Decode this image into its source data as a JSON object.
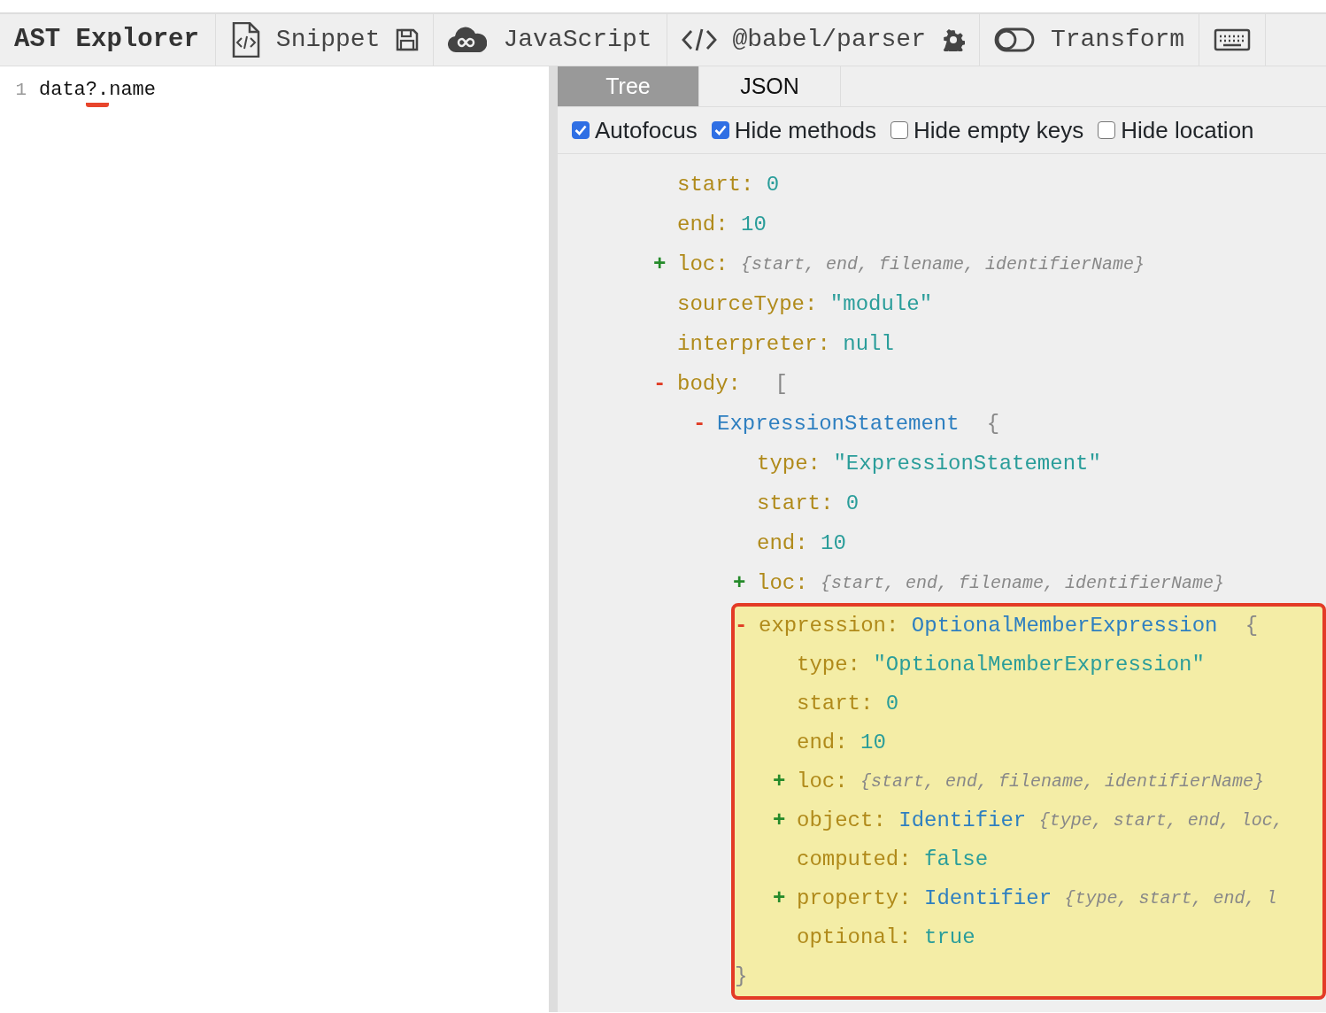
{
  "toolbar": [
    {
      "kind": "brand",
      "label": "AST Explorer"
    },
    {
      "kind": "item",
      "label": "Snippet"
    },
    {
      "kind": "item",
      "label": "JavaScript"
    },
    {
      "kind": "item",
      "label": "@babel/parser"
    },
    {
      "kind": "item",
      "label": "Transform"
    },
    {
      "kind": "item"
    }
  ],
  "editor": {
    "lines": [
      {
        "number": "1",
        "segments": [
          {
            "text": "data",
            "marked": false
          },
          {
            "text": "?.",
            "marked": true
          },
          {
            "text": "name",
            "marked": false
          }
        ]
      }
    ]
  },
  "tabs": [
    {
      "label": "Tree",
      "selected": true
    },
    {
      "label": "JSON",
      "selected": false
    }
  ],
  "options": [
    {
      "label": "Autofocus",
      "checked": true
    },
    {
      "label": "Hide methods",
      "checked": true
    },
    {
      "label": "Hide empty keys",
      "checked": false
    },
    {
      "label": "Hide location",
      "checked": false
    }
  ],
  "tree": [
    {
      "key": "start:",
      "value": "0",
      "kind": "literal"
    },
    {
      "key": "end:",
      "value": "10",
      "kind": "literal"
    },
    {
      "toggle": "+",
      "key": "loc:",
      "expanded": false,
      "value": "{start, end, filename, identifierName}",
      "kind": "summary"
    },
    {
      "key": "sourceType:",
      "value": "\"module\"",
      "kind": "literal"
    },
    {
      "key": "interpreter:",
      "value": "null",
      "kind": "literal"
    },
    {
      "toggle": "-",
      "key": "body:",
      "expanded": true,
      "bracket": "[",
      "children": [
        {
          "toggle": "-",
          "value": "ExpressionStatement",
          "kind": "type",
          "expanded": true,
          "bracket": "{",
          "children": [
            {
              "key": "type:",
              "value": "\"ExpressionStatement\"",
              "kind": "literal"
            },
            {
              "key": "start:",
              "value": "0",
              "kind": "literal"
            },
            {
              "key": "end:",
              "value": "10",
              "kind": "literal"
            },
            {
              "toggle": "+",
              "key": "loc:",
              "expanded": false,
              "value": "{start, end, filename, identifierName}",
              "kind": "summary"
            },
            {
              "toggle": "-",
              "key": "expression:",
              "value": "OptionalMemberExpression",
              "kind": "type",
              "expanded": true,
              "highlighted": true,
              "bracket": "{",
              "closing": "}",
              "children": [
                {
                  "key": "type:",
                  "value": "\"OptionalMemberExpression\"",
                  "kind": "literal"
                },
                {
                  "key": "start:",
                  "value": "0",
                  "kind": "literal"
                },
                {
                  "key": "end:",
                  "value": "10",
                  "kind": "literal"
                },
                {
                  "toggle": "+",
                  "key": "loc:",
                  "expanded": false,
                  "value": "{start, end, filename, identifierName}",
                  "kind": "summary"
                },
                {
                  "toggle": "+",
                  "key": "object:",
                  "expanded": false,
                  "value": "Identifier",
                  "kind": "type",
                  "summary": "{type, start, end, loc,"
                },
                {
                  "key": "computed:",
                  "value": "false",
                  "kind": "literal"
                },
                {
                  "toggle": "+",
                  "key": "property:",
                  "expanded": false,
                  "value": "Identifier",
                  "kind": "type",
                  "summary": "{type, start, end, l"
                },
                {
                  "key": "optional:",
                  "value": "true",
                  "kind": "literal"
                }
              ]
            }
          ]
        }
      ]
    }
  ]
}
